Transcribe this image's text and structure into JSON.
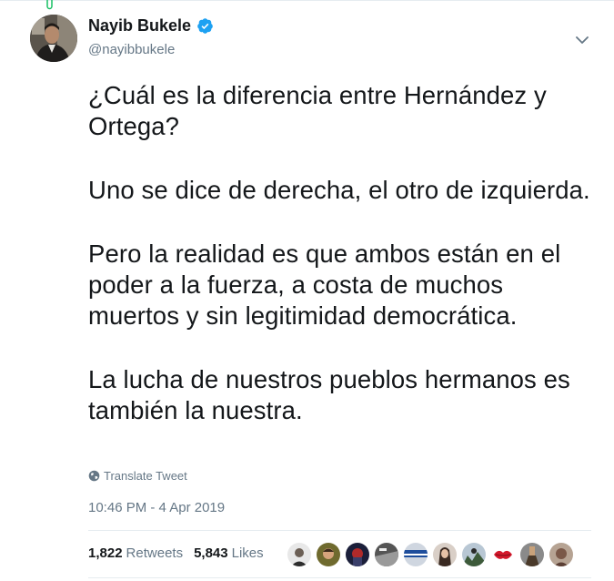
{
  "tweet": {
    "display_name": "Nayib Bukele",
    "handle": "@nayibbukele",
    "paragraphs": [
      "¿Cuál es la diferencia entre Hernández y Ortega?",
      "Uno se dice de derecha, el otro de izquierda.",
      "Pero la realidad es que ambos están en el poder a la fuerza, a costa de muchos muertos y sin legitimidad democrática.",
      "La lucha de nuestros pueblos hermanos es también la nuestra."
    ],
    "translate_label": "Translate Tweet",
    "timestamp": "10:46 PM - 4 Apr 2019"
  },
  "stats": {
    "retweets_count": "1,822",
    "retweets_label": "Retweets",
    "likes_count": "5,843",
    "likes_label": "Likes"
  },
  "icons": {
    "verified": "verified-badge-icon",
    "chevron": "chevron-down-icon",
    "translate": "globe-icon"
  },
  "colors": {
    "verified_blue": "#1da1f2",
    "secondary_text": "#657786",
    "primary_text": "#14171a"
  }
}
